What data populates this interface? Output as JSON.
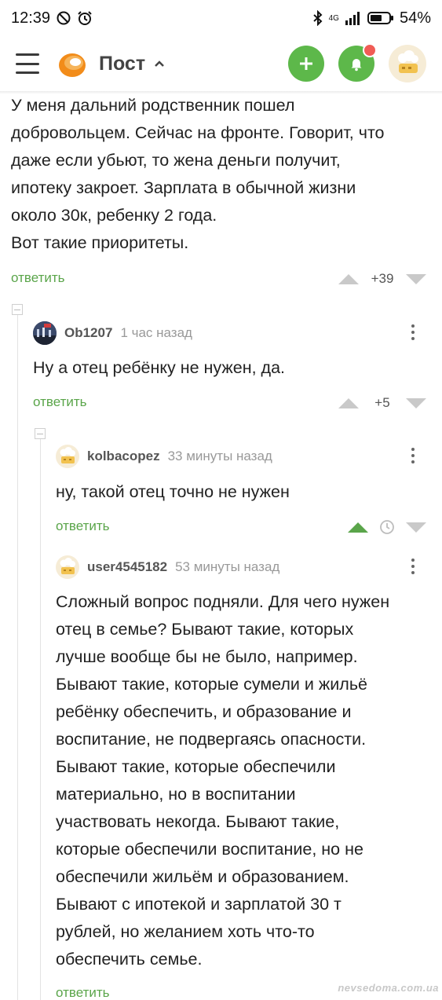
{
  "status_bar": {
    "time": "12:39",
    "network": "4G",
    "battery": "54%"
  },
  "app_bar": {
    "title": "Пост"
  },
  "post_comment": {
    "lines": [
      "У меня дальний родственник пошел",
      "добровольцем. Сейчас на фронте. Говорит, что",
      "даже если убьют, то жена деньги получит,",
      "ипотеку закроет. Зарплата в обычной жизни",
      "около 30к, ребенку 2 года.",
      "Вот такие приоритеты."
    ],
    "reply_label": "ответить",
    "rating": "+39"
  },
  "comment_1": {
    "author": "Ob1207",
    "time": "1 час назад",
    "text": "Ну а отец ребёнку не нужен, да.",
    "reply_label": "ответить",
    "rating": "+5"
  },
  "comment_2": {
    "author": "kolbacopez",
    "time": "33 минуты назад",
    "text": "ну, такой отец точно не нужен",
    "reply_label": "ответить"
  },
  "comment_3": {
    "author": "user4545182",
    "time": "53 минуты назад",
    "lines": [
      "Сложный вопрос подняли. Для чего нужен",
      "отец в семье? Бывают такие, которых",
      "лучше вообще бы не было, например.",
      "Бывают такие, которые сумели и жильё",
      "ребёнку обеспечить, и образование и",
      "воспитание, не подвергаясь опасности.",
      "Бывают такие, которые обеспечили",
      "материально, но в воспитании",
      "участвовать некогда. Бывают такие,",
      "которые обеспечили воспитание, но не",
      "обеспечили жильём и образованием.",
      "Бывают с ипотекой и зарплатой 30 т",
      "рублей, но желанием хоть что-то",
      "обеспечить семье."
    ],
    "reply_label": "ответить"
  },
  "watermark": "nevsedoma.com.ua",
  "colors": {
    "accent_green": "#5db84a",
    "reply_green": "#5aa54a",
    "notification_red": "#f05c55"
  }
}
